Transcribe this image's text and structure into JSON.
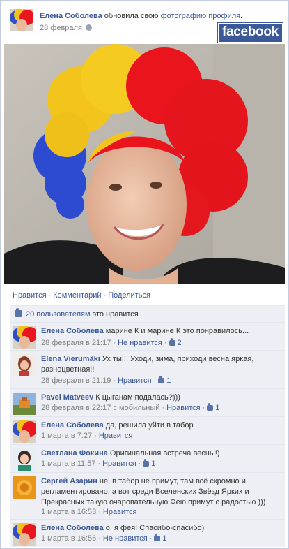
{
  "post": {
    "author": "Елена Соболева",
    "action": " обновила свою ",
    "action_link": "фотографию профиля",
    "action_end": ".",
    "date": "28 февраля"
  },
  "brand": {
    "logo_text": "facebook",
    "color": "#3b5998"
  },
  "actions": {
    "like": "Нравится",
    "comment": "Комментарий",
    "share": "Поделиться",
    "separator": "·"
  },
  "likes": {
    "count_link": "20 пользователям",
    "text": " это нравится"
  },
  "comments": [
    {
      "author": "Елена Соболева",
      "text": "марине К и марине К это понравилось...",
      "time": "28 февраля в 21:17",
      "like_action": "Не нравится",
      "likes": "2"
    },
    {
      "author": "Elena Vierumäki",
      "text": "Ух ты!!! Уходи, зима, приходи весна яркая, разноцветная!!",
      "time": "28 февраля в 21:19",
      "like_action": "Нравится",
      "likes": "1"
    },
    {
      "author": "Pavel Matveev",
      "text": "К цыганам подалась?)))",
      "time": "28 февраля в 22:17 с мобильный",
      "like_action": "Нравится",
      "likes": "1"
    },
    {
      "author": "Елена Соболева",
      "text": "да, решила уйти в табор",
      "time": "1 марта в 7:27",
      "like_action": "Нравится",
      "likes": ""
    },
    {
      "author": "Светлана Фокина",
      "text": "Оригинальная встреча весны!)",
      "time": "1 марта в 11:57",
      "like_action": "Нравится",
      "likes": "1"
    },
    {
      "author": "Сергей Азарин",
      "text": "не, в табор не примут, там всё скромно и регламентировано, а вот среди Вселенских Звёзд Ярких и Прекрасных такую очаровательную Фею примут с радостью )))",
      "time": "1 марта в 16:53",
      "like_action": "Нравится",
      "likes": ""
    },
    {
      "author": "Елена Соболева",
      "text": "о, я фея! Спасибо-спасибо)",
      "time": "1 марта в 16:56",
      "like_action": "Не нравится",
      "likes": "1"
    }
  ],
  "icons": {
    "privacy": "globe-icon",
    "like": "thumbs-up-icon"
  }
}
